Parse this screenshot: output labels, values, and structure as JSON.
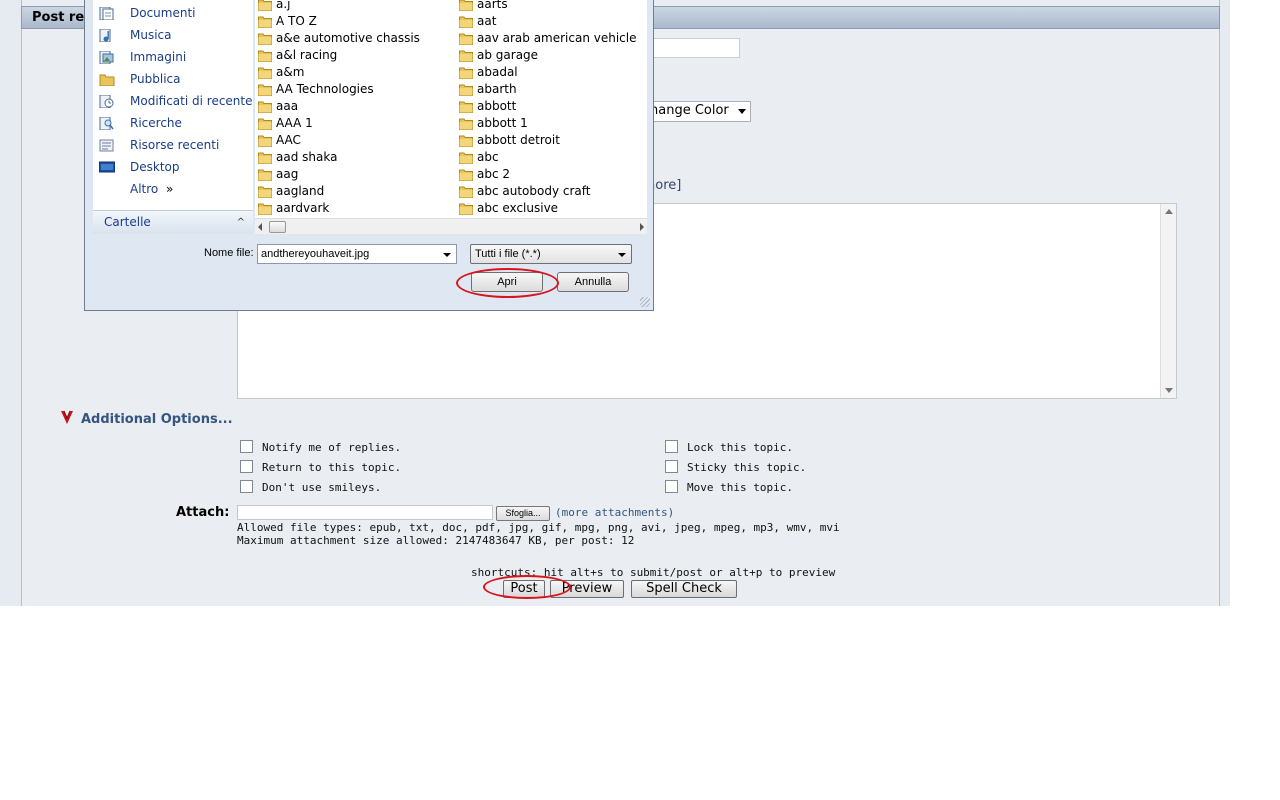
{
  "forum": {
    "section_title": "Post re",
    "color_select_value": "hange Color",
    "more_smileys": "nore]",
    "additional_options": "Additional Options...",
    "options_left": [
      "Notify me of replies.",
      "Return to this topic.",
      "Don't use smileys."
    ],
    "options_right": [
      "Lock this topic.",
      "Sticky this topic.",
      "Move this topic."
    ],
    "attach_label": "Attach:",
    "browse_button": "Sfoglia...",
    "more_attachments": "(more attachments)",
    "allowed_types": "Allowed file types: epub, txt, doc, pdf, jpg, gif, mpg, png, avi, jpeg, mpeg, mp3, wmv, mvi",
    "max_size": "Maximum attachment size allowed: 2147483647 KB, per post: 12",
    "shortcuts": "shortcuts: hit alt+s to submit/post or alt+p to preview",
    "post_button": "Post",
    "preview_button": "Preview",
    "spellcheck_button": "Spell Check"
  },
  "dialog": {
    "nav_items": [
      {
        "label": "Documenti",
        "icon": "documents-icon"
      },
      {
        "label": "Musica",
        "icon": "music-icon"
      },
      {
        "label": "Immagini",
        "icon": "pictures-icon"
      },
      {
        "label": "Pubblica",
        "icon": "public-folder-icon"
      },
      {
        "label": "Modificati di recente",
        "icon": "recently-changed-icon"
      },
      {
        "label": "Ricerche",
        "icon": "searches-icon"
      },
      {
        "label": "Risorse recenti",
        "icon": "recent-items-icon"
      },
      {
        "label": "Desktop",
        "icon": "desktop-icon"
      },
      {
        "label": "Altro",
        "icon": ""
      }
    ],
    "altro_chevron": "»",
    "folders_label": "Cartelle",
    "folders_chevron": "^",
    "files_col1": [
      "a.j",
      "A TO Z",
      "a&e automotive chassis",
      "a&l racing",
      "a&m",
      "AA Technologies",
      "aaa",
      "AAA 1",
      "AAC",
      "aad shaka",
      "aag",
      "aagland",
      "aardvark"
    ],
    "files_col2": [
      "aarts",
      "aat",
      "aav arab american vehicle",
      "ab garage",
      "abadal",
      "abarth",
      "abbott",
      "abbott 1",
      "abbott detroit",
      "abc",
      "abc 2",
      "abc autobody craft",
      "abc exclusive"
    ],
    "filename_label": "Nome file:",
    "filename_value": "andthereyouhaveit.jpg",
    "filetype_value": "Tutti i file (*.*)",
    "open_button": "Apri",
    "cancel_button": "Annulla"
  },
  "colors": {
    "annotation_red": "#d9141c",
    "link_blue": "#1b3d87",
    "header_blue": "#33557f"
  }
}
